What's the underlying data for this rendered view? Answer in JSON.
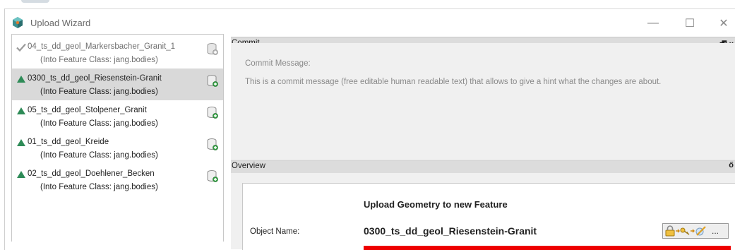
{
  "window": {
    "title": "Upload Wizard",
    "controls": {
      "minimize": "—",
      "maximize": "☐",
      "close": "✕"
    }
  },
  "sidebar": {
    "items": [
      {
        "name": "04_ts_dd_geol_Markersbacher_Granit_1",
        "sub": "(Into Feature Class: jang.bodies)",
        "status": "checkmark-icon",
        "selected": false
      },
      {
        "name": "0300_ts_dd_geol_Riesenstein-Granit",
        "sub": "(Into Feature Class: jang.bodies)",
        "status": "green-triangle-icon",
        "selected": true
      },
      {
        "name": "05_ts_dd_geol_Stolpener_Granit",
        "sub": "(Into Feature Class: jang.bodies)",
        "status": "green-triangle-icon",
        "selected": false
      },
      {
        "name": "01_ts_dd_geol_Kreide",
        "sub": "(Into Feature Class: jang.bodies)",
        "status": "green-triangle-icon",
        "selected": false
      },
      {
        "name": "02_ts_dd_geol_Doehlener_Becken",
        "sub": "(Into Feature Class: jang.bodies)",
        "status": "green-triangle-icon",
        "selected": false
      }
    ]
  },
  "commit": {
    "header": "Commit",
    "pin": "🗗 ×",
    "message_label": "Commit Message:",
    "message_text": "This is a commit message (free editable human readable text) that allows to give a hint what the changes are about."
  },
  "overview": {
    "header": "Overview",
    "pin": "ő",
    "card_title": "Upload Geometry to new Feature",
    "object_name_label": "Object Name:",
    "object_name_value": "0300_ts_dd_geol_Riesenstein-Granit",
    "actions_more": "...",
    "accent_color": "#ee0000"
  },
  "colors": {
    "selected_row": "#d9d9d9",
    "status_green": "#2e8b57",
    "panel_bg": "#f0f0f0"
  }
}
